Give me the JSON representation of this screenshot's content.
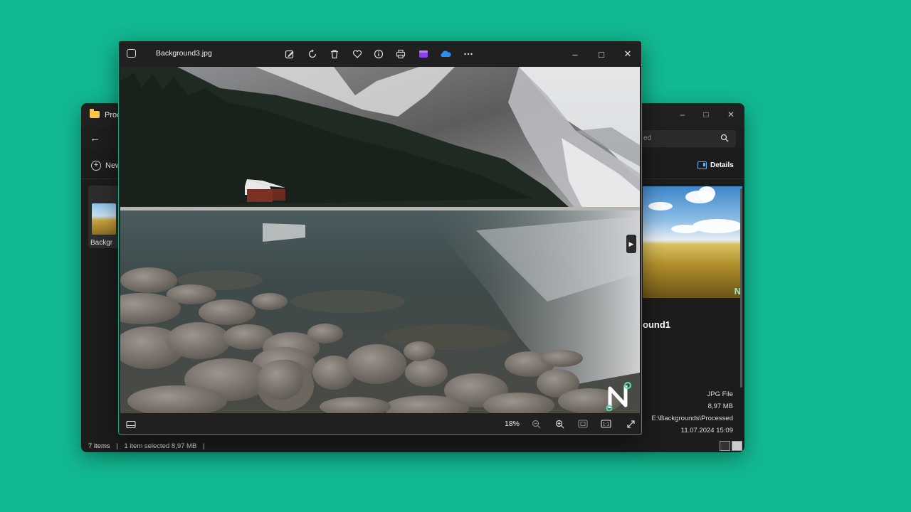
{
  "explorer": {
    "title": "Proc",
    "search_placeholder": "ed",
    "new_label": "New",
    "details_label": "Details",
    "file_label": "Backgr",
    "preview_name": "ound1",
    "props": {
      "type": "JPG File",
      "size": "8,97 MB",
      "path": "E:\\Backgrounds\\Processed",
      "date": "11.07.2024 15:09"
    },
    "status": {
      "items": "7 items",
      "selected": "1 item selected  8,97 MB"
    }
  },
  "photos": {
    "filename": "Background3.jpg",
    "zoom": "18%",
    "toolbar_icons": [
      "edit-icon",
      "rotate-icon",
      "delete-icon",
      "favorite-icon",
      "info-icon",
      "print-icon",
      "clipchamp-icon",
      "onedrive-icon",
      "more-icon"
    ],
    "bottom_icons": [
      "filmstrip-icon",
      "zoom-out-icon",
      "zoom-in-icon",
      "fit-icon",
      "actual-size-icon",
      "fullscreen-icon"
    ]
  },
  "colors": {
    "desktop": "#12b891",
    "accent": "#10a585",
    "window": "#1f1f1f"
  }
}
